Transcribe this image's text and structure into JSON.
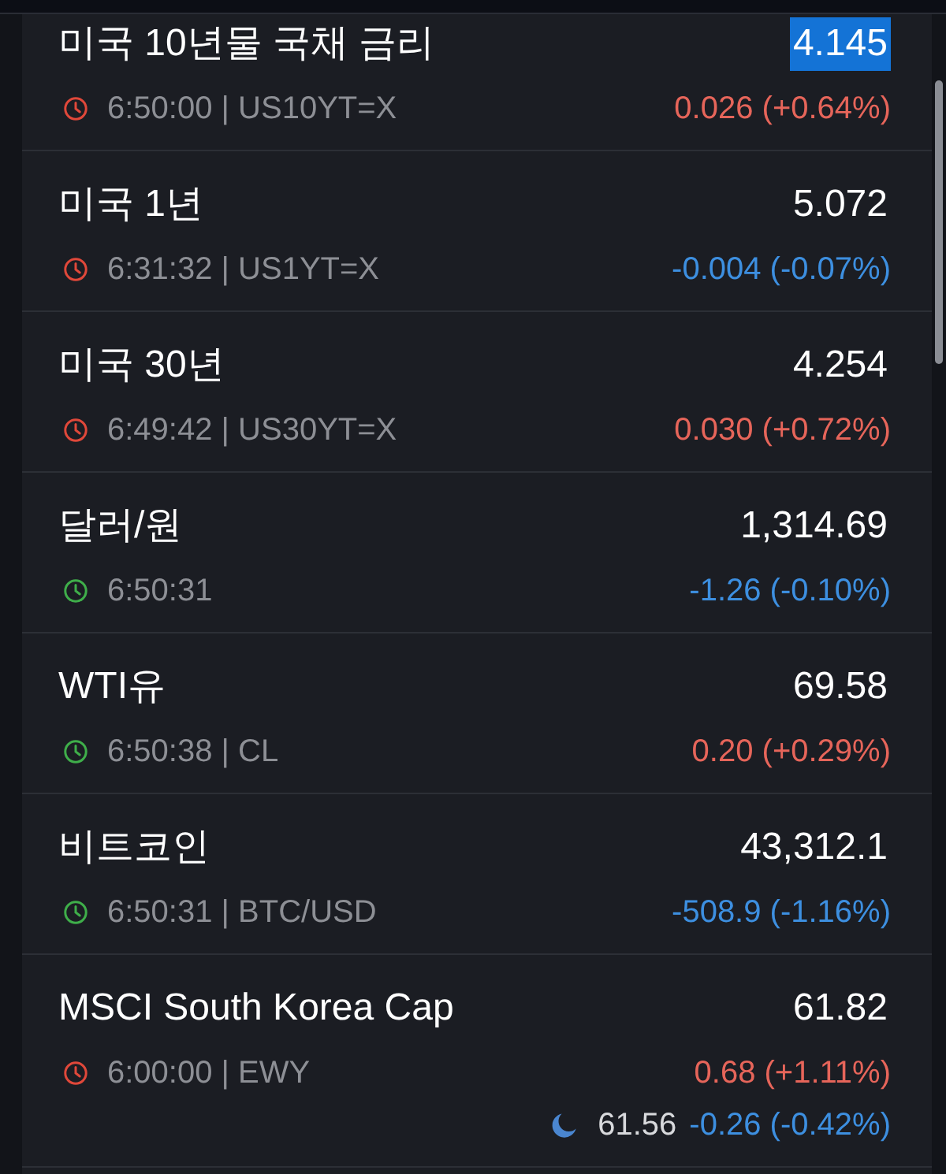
{
  "quotes": [
    {
      "name": "미국 10년물 국채 금리",
      "price": "4.145",
      "price_flash": true,
      "market_open": false,
      "time_symbol": "6:50:00 | US10YT=X",
      "change": "0.026 (+0.64%)",
      "color": "#e6655a"
    },
    {
      "name": "미국 1년",
      "price": "5.072",
      "price_flash": false,
      "market_open": false,
      "time_symbol": "6:31:32 | US1YT=X",
      "change": "-0.004 (-0.07%)",
      "color": "#3d8fe0"
    },
    {
      "name": "미국 30년",
      "price": "4.254",
      "price_flash": false,
      "market_open": false,
      "time_symbol": "6:49:42 | US30YT=X",
      "change": "0.030 (+0.72%)",
      "color": "#e6655a"
    },
    {
      "name": "달러/원",
      "price": "1,314.69",
      "price_flash": false,
      "market_open": true,
      "time_symbol": "6:50:31",
      "change": "-1.26 (-0.10%)",
      "color": "#3d8fe0"
    },
    {
      "name": "WTI유",
      "price": "69.58",
      "price_flash": false,
      "market_open": true,
      "time_symbol": "6:50:38 | CL",
      "change": "0.20 (+0.29%)",
      "color": "#e6655a"
    },
    {
      "name": "비트코인",
      "price": "43,312.1",
      "price_flash": false,
      "market_open": true,
      "time_symbol": "6:50:31 | BTC/USD",
      "change": "-508.9 (-1.16%)",
      "color": "#3d8fe0"
    },
    {
      "name": "MSCI South Korea Cap",
      "price": "61.82",
      "price_flash": false,
      "market_open": false,
      "time_symbol": "6:00:00 | EWY",
      "change": "0.68 (+1.11%)",
      "color": "#e6655a",
      "after_hours": {
        "price": "61.56",
        "change": "-0.26 (-0.42%)",
        "color": "#3d8fe0"
      }
    }
  ]
}
